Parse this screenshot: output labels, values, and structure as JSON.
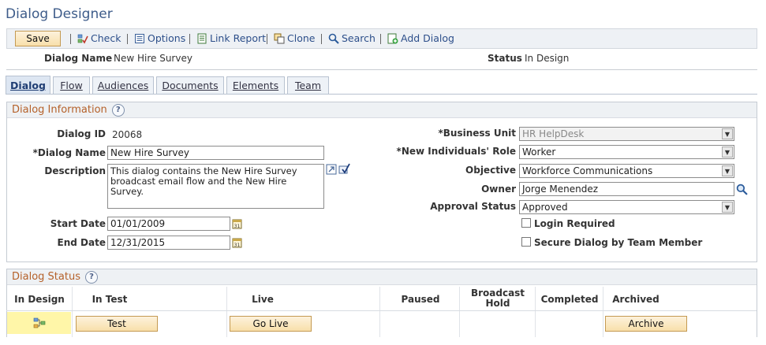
{
  "page": {
    "title": "Dialog Designer"
  },
  "toolbar": {
    "save_label": "Save",
    "check_label": "Check",
    "options_label": "Options",
    "link_report_label": "Link Report",
    "clone_label": "Clone",
    "search_label": "Search",
    "add_dialog_label": "Add Dialog"
  },
  "header": {
    "dialog_name_label": "Dialog Name",
    "dialog_name_value": "New Hire Survey",
    "status_label": "Status",
    "status_value": "In Design"
  },
  "tabs": [
    {
      "label": "Dialog",
      "active": true
    },
    {
      "label": "Flow",
      "active": false
    },
    {
      "label": "Audiences",
      "active": false
    },
    {
      "label": "Documents",
      "active": false
    },
    {
      "label": "Elements",
      "active": false
    },
    {
      "label": "Team",
      "active": false
    }
  ],
  "dialog_info": {
    "section_title": "Dialog Information",
    "dialog_id_label": "Dialog ID",
    "dialog_id_value": "20068",
    "dialog_name_label": "*Dialog Name",
    "dialog_name_value": "New Hire Survey",
    "description_label": "Description",
    "description_value": "This dialog contains the New Hire Survey broadcast email flow and the New Hire Survey.",
    "start_date_label": "Start Date",
    "start_date_value": "01/01/2009",
    "end_date_label": "End Date",
    "end_date_value": "12/31/2015",
    "business_unit_label": "*Business Unit",
    "business_unit_value": "HR HelpDesk",
    "new_individuals_role_label": "*New Individuals' Role",
    "new_individuals_role_value": "Worker",
    "objective_label": "Objective",
    "objective_value": "Workforce Communications",
    "owner_label": "Owner",
    "owner_value": "Jorge Menendez",
    "approval_status_label": "Approval Status",
    "approval_status_value": "Approved",
    "login_required_label": "Login Required",
    "login_required_checked": false,
    "secure_dialog_label": "Secure Dialog by Team Member",
    "secure_dialog_checked": false
  },
  "dialog_status": {
    "section_title": "Dialog Status",
    "columns": [
      "In Design",
      "In Test",
      "Live",
      "Paused",
      "Broadcast Hold",
      "Completed",
      "Archived"
    ],
    "broadcast_hold_line1": "Broadcast",
    "broadcast_hold_line2": "Hold",
    "test_button_label": "Test",
    "go_live_button_label": "Go Live",
    "archive_button_label": "Archive",
    "current_status_icon": "flow-icon"
  },
  "colors": {
    "title": "#3e5c8a",
    "section_title": "#b5612a",
    "current_status_highlight": "#fff6a8",
    "button_bg": "#f8dfaa"
  }
}
